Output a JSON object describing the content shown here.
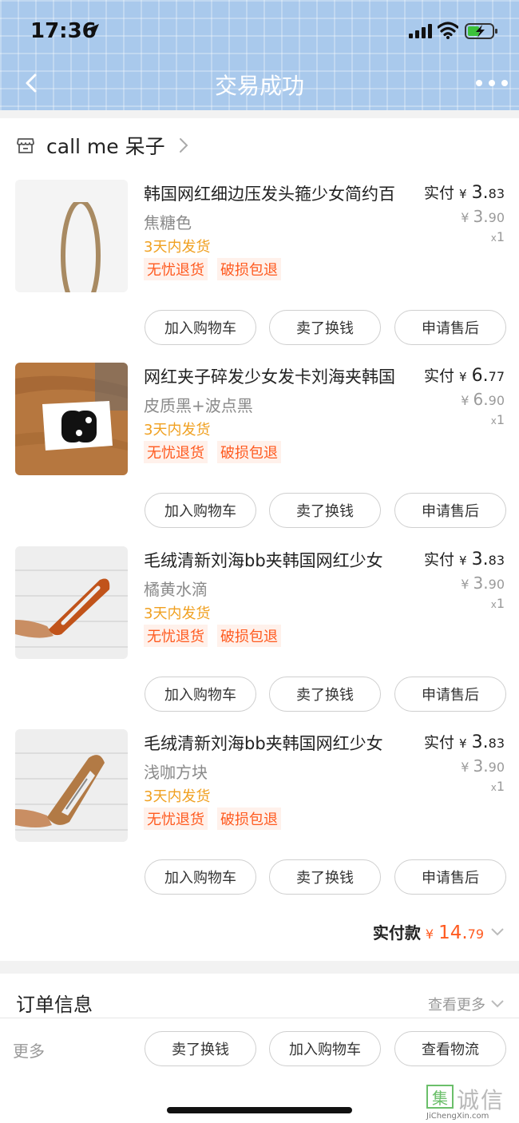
{
  "status_bar": {
    "time": "17:36"
  },
  "nav": {
    "title": "交易成功"
  },
  "shop": {
    "name": "call me 呆子"
  },
  "items": [
    {
      "title": "韩国网红细边压发头箍少女简约百",
      "variant": "焦糖色",
      "ship": "3天内发货",
      "tags": [
        "无忧退货",
        "破损包退"
      ],
      "paid_label": "实付",
      "currency": "¥",
      "paid_int": "3.",
      "paid_dec": "83",
      "orig_int": "3.",
      "orig_dec": "90",
      "qty_x": "x",
      "qty": "1",
      "thumb_icon": "headband-thumbnail"
    },
    {
      "title": "网红夹子碎发少女发卡刘海夹韩国",
      "variant": "皮质黑+波点黑",
      "ship": "3天内发货",
      "tags": [
        "无忧退货",
        "破损包退"
      ],
      "paid_label": "实付",
      "currency": "¥",
      "paid_int": "6.",
      "paid_dec": "77",
      "orig_int": "6.",
      "orig_dec": "90",
      "qty_x": "x",
      "qty": "1",
      "thumb_icon": "hair-clip-black-thumbnail"
    },
    {
      "title": "毛绒清新刘海bb夹韩国网红少女",
      "variant": "橘黄水滴",
      "ship": "3天内发货",
      "tags": [
        "无忧退货",
        "破损包退"
      ],
      "paid_label": "实付",
      "currency": "¥",
      "paid_int": "3.",
      "paid_dec": "83",
      "orig_int": "3.",
      "orig_dec": "90",
      "qty_x": "x",
      "qty": "1",
      "thumb_icon": "plush-clip-orange-thumbnail"
    },
    {
      "title": "毛绒清新刘海bb夹韩国网红少女",
      "variant": "浅咖方块",
      "ship": "3天内发货",
      "tags": [
        "无忧退货",
        "破损包退"
      ],
      "paid_label": "实付",
      "currency": "¥",
      "paid_int": "3.",
      "paid_dec": "83",
      "orig_int": "3.",
      "orig_dec": "90",
      "qty_x": "x",
      "qty": "1",
      "thumb_icon": "plush-clip-brown-thumbnail"
    }
  ],
  "item_buttons": {
    "add_cart": "加入购物车",
    "resell": "卖了换钱",
    "after_sale": "申请售后"
  },
  "total": {
    "label": "实付款",
    "currency": "¥",
    "int": "14.",
    "dec": "79"
  },
  "order_info": {
    "title": "订单信息",
    "view_more": "查看更多"
  },
  "bottom_bar": {
    "more": "更多",
    "resell": "卖了换钱",
    "add_cart": "加入购物车",
    "logistics": "查看物流"
  },
  "watermark": {
    "logo_char": "集",
    "text": "诚信",
    "url": "JiChengXin.com"
  },
  "colors": {
    "header_bg": "#a9c9ec",
    "accent": "#ff5a1f",
    "ship": "#f0a020"
  }
}
